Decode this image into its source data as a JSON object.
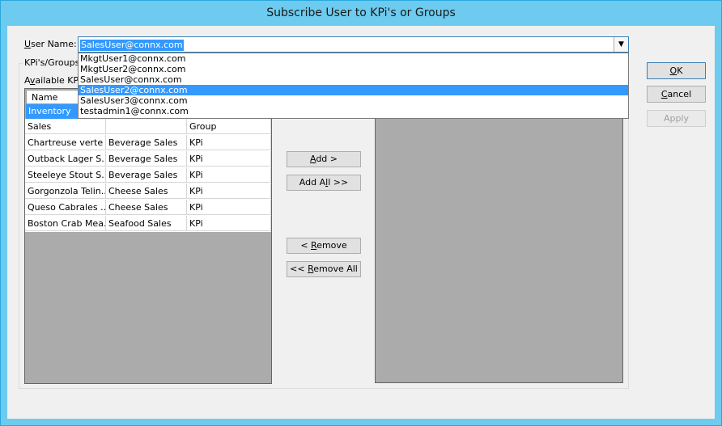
{
  "window": {
    "title": "Subscribe User to KPi's or Groups"
  },
  "user_name": {
    "label_accel": "U",
    "label_rest": "ser Name:",
    "value": "SalesUser@connx.com",
    "options": [
      "MkgtUser1@connx.com",
      "MkgtUser2@connx.com",
      "SalesUser@connx.com",
      "SalesUser2@connx.com",
      "SalesUser3@connx.com",
      "testadmin1@connx.com"
    ],
    "highlighted_option": "SalesUser2@connx.com"
  },
  "groupbox": {
    "label": "KPi's/Groups"
  },
  "available": {
    "label_pre": "A",
    "label_accel": "v",
    "label_rest": "ailable KPi's",
    "column_header": "Name",
    "selected_group": "Inventory",
    "group_header_row": [
      "Sales",
      "",
      "Group"
    ],
    "rows": [
      [
        "Chartreuse verte ...",
        "Beverage Sales",
        "KPi"
      ],
      [
        "Outback Lager S...",
        "Beverage Sales",
        "KPi"
      ],
      [
        "Steeleye Stout S...",
        "Beverage Sales",
        "KPi"
      ],
      [
        "Gorgonzola Telin...",
        "Cheese Sales",
        "KPi"
      ],
      [
        "Queso Cabrales ...",
        "Cheese Sales",
        "KPi"
      ],
      [
        "Boston Crab Mea...",
        "Seafood Sales",
        "KPi"
      ]
    ]
  },
  "buttons": {
    "add": {
      "accel": "A",
      "rest": "dd >"
    },
    "add_all": {
      "pre": "Add A",
      "accel": "l",
      "rest": "l >>"
    },
    "remove": {
      "pre": "< ",
      "accel": "R",
      "rest": "emove"
    },
    "remove_all": {
      "pre": "<< ",
      "accel": "R",
      "rest": "emove All"
    },
    "ok": {
      "accel": "O",
      "rest": "K"
    },
    "cancel": {
      "accel": "C",
      "rest": "ancel"
    },
    "apply": {
      "label": "Apply"
    }
  },
  "colors": {
    "title_bar": "#6ccbef",
    "selection": "#3399ff",
    "grid_background": "#ababab",
    "dialog_background": "#f0f0f0"
  }
}
